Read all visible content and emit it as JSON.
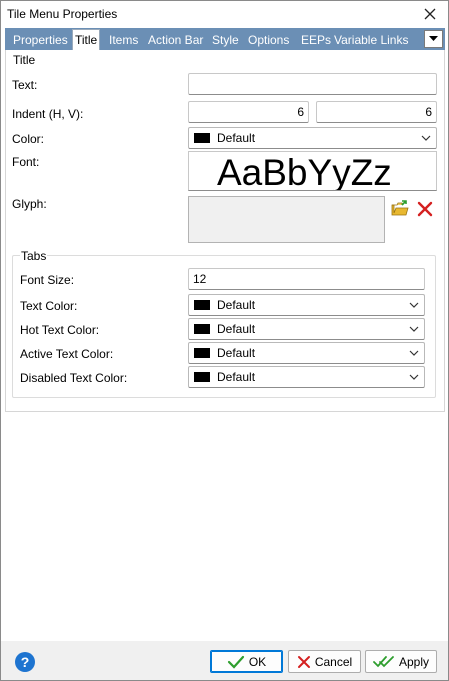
{
  "window": {
    "title": "Tile Menu Properties"
  },
  "tabs": [
    {
      "label": "Properties"
    },
    {
      "label": "Title"
    },
    {
      "label": "Items"
    },
    {
      "label": "Action Bar"
    },
    {
      "label": "Style"
    },
    {
      "label": "Options"
    },
    {
      "label": "EEPs"
    },
    {
      "label": "Variable Links"
    }
  ],
  "active_tab": "Title",
  "title_group": {
    "label": "Title",
    "text_label": "Text:",
    "text_value": "",
    "indent_label": "Indent (H, V):",
    "indent_h": "6",
    "indent_v": "6",
    "color_label": "Color:",
    "color_value": "Default",
    "color_swatch": "#000000",
    "font_label": "Font:",
    "font_preview": "AaBbYyZz",
    "glyph_label": "Glyph:"
  },
  "tabs_group": {
    "label": "Tabs",
    "font_size_label": "Font Size:",
    "font_size_value": "12",
    "text_color_label": "Text Color:",
    "text_color_value": "Default",
    "hot_text_color_label": "Hot Text Color:",
    "hot_text_color_value": "Default",
    "active_text_color_label": "Active Text Color:",
    "active_text_color_value": "Default",
    "disabled_text_color_label": "Disabled Text Color:",
    "disabled_text_color_value": "Default"
  },
  "footer": {
    "help_label": "?",
    "ok_label": "OK",
    "cancel_label": "Cancel",
    "apply_label": "Apply"
  },
  "colors": {
    "tab_bar": "#6b8fb5",
    "accent": "#0078d7",
    "ok_check": "#2e9e2e",
    "cancel_x": "#d42020"
  }
}
